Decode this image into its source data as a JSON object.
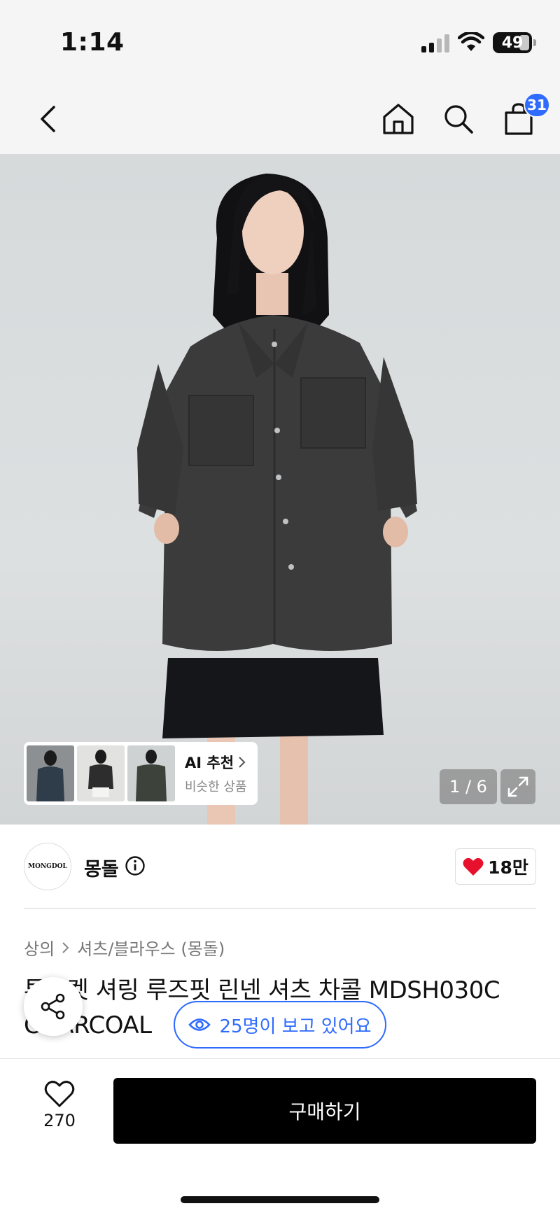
{
  "status_bar": {
    "time": "1:14",
    "battery": "49"
  },
  "nav": {
    "cart_count": "31"
  },
  "hero": {
    "ai_card": {
      "title": "AI 추천",
      "subtitle": "비슷한 상품"
    },
    "pager": "1 / 6"
  },
  "brand": {
    "logo_text": "MONGDOL",
    "name": "몽돌",
    "like_count": "18만"
  },
  "breadcrumb": {
    "category": "상의",
    "subcategory": "셔츠/블라우스 (몽돌)"
  },
  "product": {
    "title": "투포켓 셔링 루즈핏 린넨 셔츠 차콜 MDSH030C CHARCOAL"
  },
  "viewers": "25명이 보고 있어요",
  "bottom_bar": {
    "wish_count": "270",
    "buy_label": "구매하기"
  },
  "colors": {
    "accent": "#2f6bff",
    "heart": "#e8112d",
    "buy_button": "#000000"
  }
}
